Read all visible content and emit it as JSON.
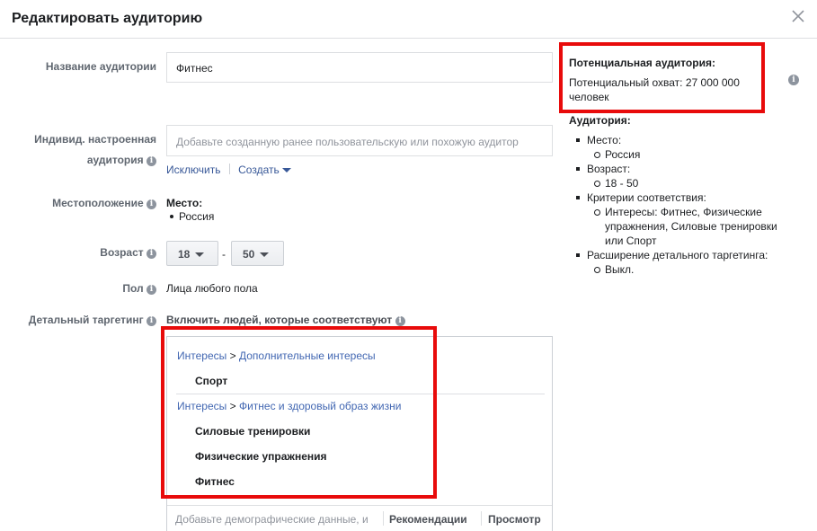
{
  "dialog": {
    "title": "Редактировать аудиторию",
    "close_icon": "close-icon"
  },
  "form": {
    "audience_name": {
      "label": "Название аудитории",
      "value": "Фитнес"
    },
    "custom_audience": {
      "label_line1": "Индивид. настроенная",
      "label_line2": "аудитория",
      "placeholder": "Добавьте созданную ранее пользовательскую или похожую аудитор",
      "exclude_link": "Исключить",
      "create_link": "Создать"
    },
    "location": {
      "label": "Местоположение",
      "heading": "Место:",
      "value": "Россия"
    },
    "age": {
      "label": "Возраст",
      "min": "18",
      "dash": "-",
      "max": "50"
    },
    "gender": {
      "label": "Пол",
      "value": "Лица любого пола"
    },
    "detailed_targeting": {
      "label": "Детальный таргетинг",
      "include_text": "Включить людей, которые соответствуют",
      "groups": [
        {
          "crumb_root": "Интересы",
          "crumb_sep": ">",
          "crumb_leaf": "Дополнительные интересы",
          "items": [
            "Спорт"
          ]
        },
        {
          "crumb_root": "Интересы",
          "crumb_sep": ">",
          "crumb_leaf": "Фитнес и здоровый образ жизни",
          "items": [
            "Силовые тренировки",
            "Физические упражнения",
            "Фитнес"
          ]
        }
      ],
      "search_placeholder": "Добавьте демографические данные, и",
      "recommendations_button": "Рекомендации",
      "browse_button": "Просмотр"
    }
  },
  "summary": {
    "potential_title": "Потенциальная аудитория:",
    "potential_reach_line1": "Потенциальный охват: 27 000 000",
    "potential_reach_line2": "человек",
    "audience_heading": "Аудитория:",
    "place_label": "Место:",
    "place_value": "Россия",
    "age_label": "Возраст:",
    "age_value": "18 - 50",
    "criteria_label": "Критерии соответствия:",
    "criteria_line1": "Интересы: Фитнес, Физические",
    "criteria_line2": "упражнения, Силовые тренировки",
    "criteria_line3": "или Спорт",
    "expansion_label": "Расширение детального таргетинга:",
    "expansion_value": "Выкл."
  },
  "colors": {
    "highlight": "#e80b0b",
    "link": "#385898"
  }
}
